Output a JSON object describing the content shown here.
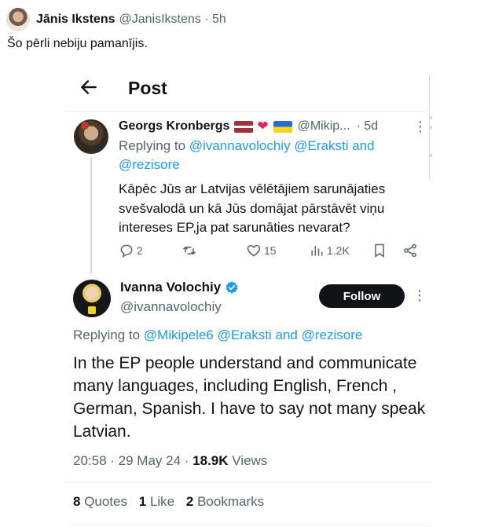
{
  "outer": {
    "name": "Jānis Ikstens",
    "handle": "@JanisIkstens · 5h",
    "text": "Šo pērli nebiju pamanījis."
  },
  "screenshot": {
    "header_title": "Post",
    "reply": {
      "name": "Georgs Kronbergs",
      "handle": "@Mikip...",
      "time": "· 5d",
      "replying_prefix": "Replying to",
      "replying_line1": "@ivannavolochiy @Eraksti and",
      "replying_line2": "@rezisore",
      "text": "Kāpēc Jūs ar Latvijas vēlētājiem sarunājaties svešvalodā un kā Jūs domājat pārstāvēt viņu intereses EP,ja pat sarunāties nevarat?",
      "replies": "2",
      "likes": "15",
      "views": "1.2K"
    },
    "main": {
      "name": "Ivanna Volochiy",
      "handle": "@ivannavolochiy",
      "follow_label": "Follow",
      "replying_prefix": "Replying to",
      "replying_to": "@Mikipele6 @Eraksti and @rezisore",
      "text": "In the EP people understand and communicate many languages, including English, French , German, Spanish. I have to say not many speak Latvian.",
      "time_date": "20:58 · 29 May 24 ·",
      "views_count": "18.9K",
      "views_label": "Views",
      "quotes_count": "8",
      "quotes_label": "Quotes",
      "likes_count": "1",
      "likes_label": "Like",
      "bookmarks_count": "2",
      "bookmarks_label": "Bookmarks"
    }
  },
  "colors": {
    "link": "#1d9bf0",
    "secondary_text": "#536471",
    "primary_text": "#0f1419",
    "follow_bg": "#0f1419"
  }
}
